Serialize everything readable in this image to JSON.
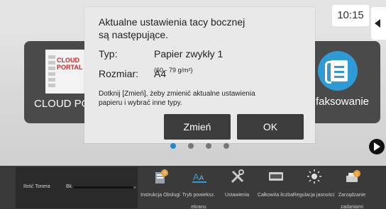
{
  "status_bar": {
    "time": "10:15"
  },
  "home": {
    "tiles": [
      {
        "label": "CLOUD PORTAL",
        "logo_text": "CLOUD PORTAL"
      },
      {
        "label": "Łatwe faksowanie"
      }
    ],
    "page_indicator": {
      "total": 4,
      "active_index": 0
    }
  },
  "dialog": {
    "message": "Aktualne ustawienia tacy bocznej są następujące.",
    "type_label": "Typ:",
    "type_value": "Papier zwykły 1",
    "type_range": "(60 - 79 g/m²)",
    "size_label": "Rozmiar:",
    "size_value": "A4",
    "hint": "Dotknij [Zmień], żeby zmienić aktualne ustawienia papieru i wybrać inne typy.",
    "change_label": "Zmień",
    "ok_label": "OK"
  },
  "toner": {
    "label": "Ilość Tonera",
    "color": "Bk",
    "level": 0.95
  },
  "shortcuts": [
    {
      "label": "Instrukcja Obsługi",
      "icon": "manual-icon"
    },
    {
      "label": "Tryb powieksz. ekranu",
      "icon": "zoom-mode-icon"
    },
    {
      "label": "Ustawienia",
      "icon": "tools-icon"
    },
    {
      "label": "Całkowita liczba",
      "icon": "counter-icon"
    },
    {
      "label": "Regulacja jasności",
      "icon": "brightness-icon"
    },
    {
      "label": "Zarządzanie zadaniami",
      "icon": "job-status-icon"
    }
  ],
  "colors": {
    "accent": "#1e88d0",
    "button_bg": "#3c3c3c",
    "bar_bg": "#3a3a3a"
  }
}
